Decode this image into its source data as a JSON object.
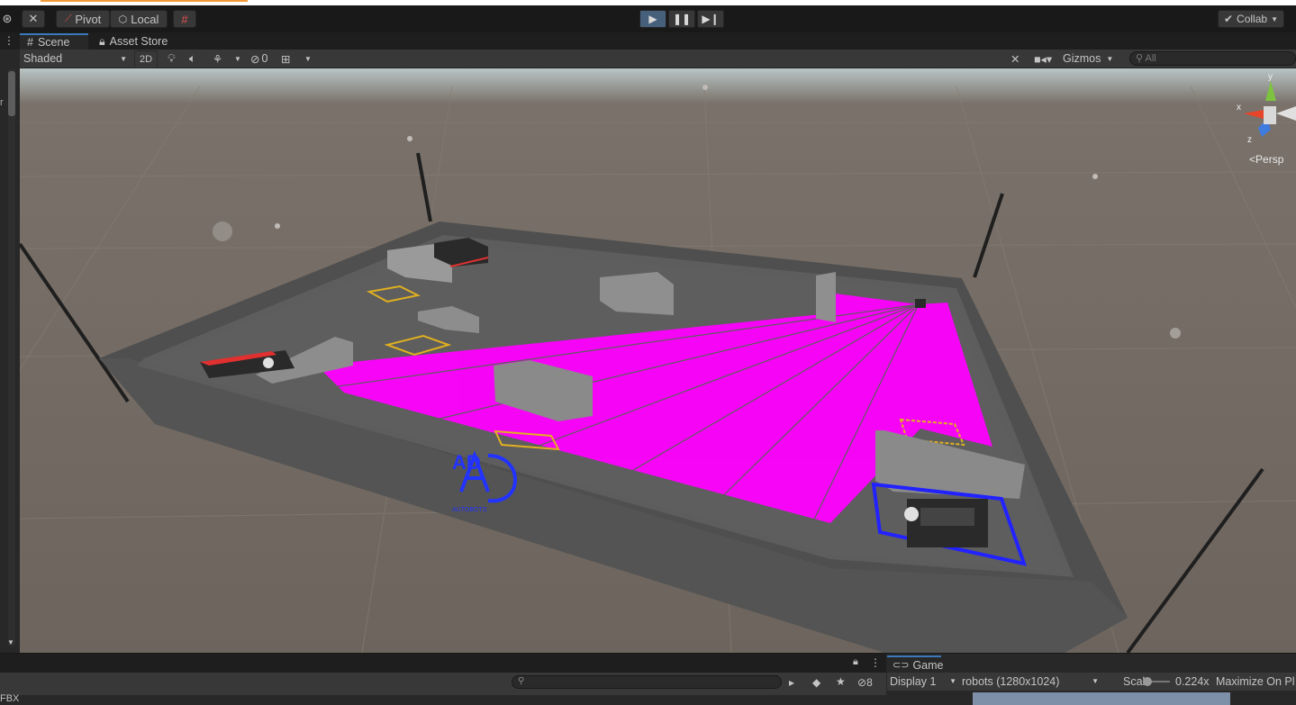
{
  "toolbar": {
    "pivot_label": "Pivot",
    "local_label": "Local",
    "collab_label": "Collab",
    "play_active": true
  },
  "tabs": {
    "scene_label": "Scene",
    "asset_store_label": "Asset Store"
  },
  "scene_bar": {
    "shading_mode": "Shaded",
    "mode_2d": "2D",
    "hidden_count": "0",
    "gizmos_label": "Gizmos",
    "search_placeholder": "All"
  },
  "gizmo": {
    "y_label": "y",
    "x_label": "x",
    "z_label": "z",
    "projection_label": "Persp"
  },
  "bottom": {
    "project_item": "FBX",
    "hidden_count": "8"
  },
  "game": {
    "tab_label": "Game",
    "display_label": "Display 1",
    "resolution_label": "robots (1280x1024)",
    "scale_label": "Scale",
    "scale_value": "0.224x",
    "maximize_label": "Maximize On Pl"
  },
  "colors": {
    "accent": "#3a79bb",
    "laser": "#ff00ff",
    "ground": "#716960",
    "wall": "#555555",
    "arena_floor": "#5b5b5b",
    "zone_outline": "#e0b020",
    "robot_zone": "#2222ff"
  },
  "arena": {
    "logo_text": "AD",
    "logo_subtitle": "AUTOBOTS"
  }
}
